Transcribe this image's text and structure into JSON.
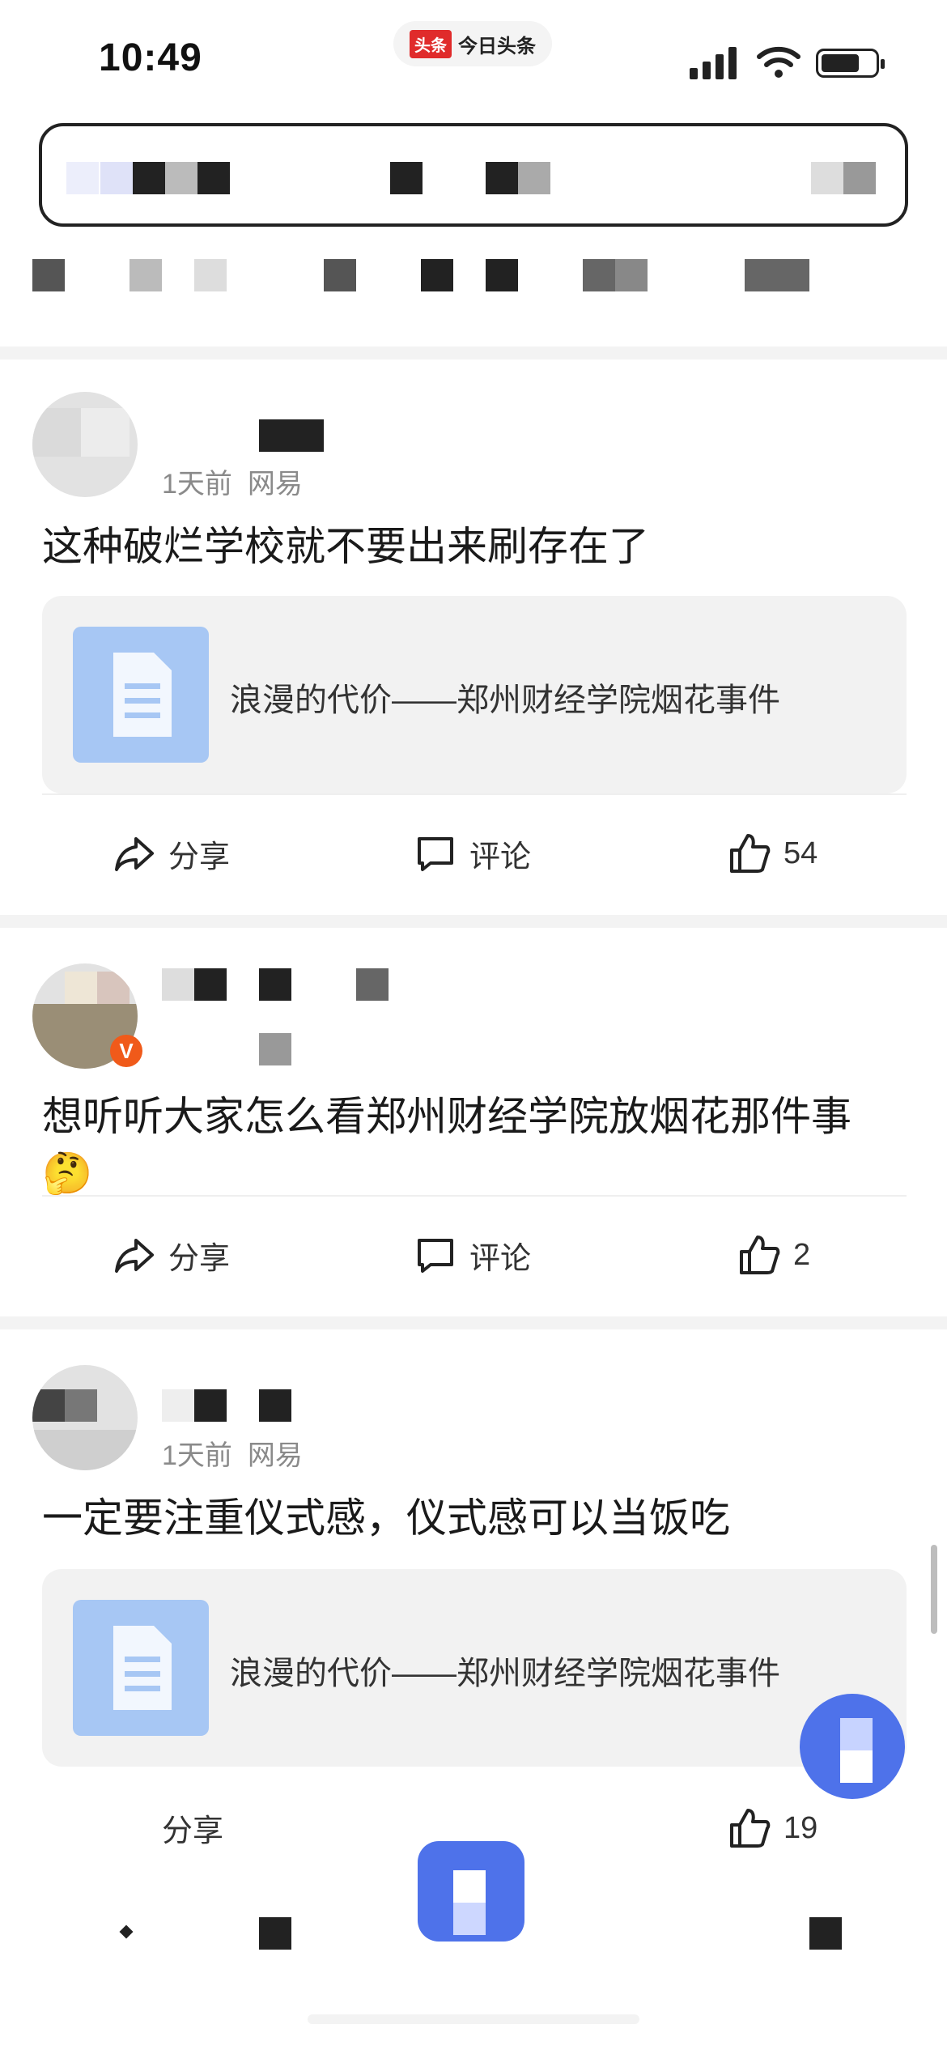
{
  "status": {
    "time": "10:49",
    "app_pill_logo": "头条",
    "app_pill_name": "今日头条"
  },
  "posts": [
    {
      "time": "1天前",
      "source": "网易",
      "text": "这种破烂学校就不要出来刷存在了",
      "card_title": "浪漫的代价——郑州财经学院烟花事件",
      "share": "分享",
      "comment": "评论",
      "likes": "54"
    },
    {
      "text_line1": "想听听大家怎么看郑州财经学院放烟花那件事",
      "emoji": "🤔",
      "share": "分享",
      "comment": "评论",
      "likes": "2"
    },
    {
      "time": "1天前",
      "source": "网易",
      "text": "一定要注重仪式感，仪式感可以当饭吃",
      "card_title": "浪漫的代价——郑州财经学院烟花事件",
      "share": "分享",
      "likes": "19"
    }
  ],
  "icons": {
    "share": "share-arrow-icon",
    "comment": "comment-bubble-icon",
    "like": "thumbs-up-icon",
    "doc": "document-icon",
    "verified": "verified-v-icon"
  },
  "colors": {
    "accent": "#4e72ea",
    "card_bg": "#f2f2f2",
    "doc_bg": "#a7c7f4",
    "verified": "#f05a1a"
  }
}
